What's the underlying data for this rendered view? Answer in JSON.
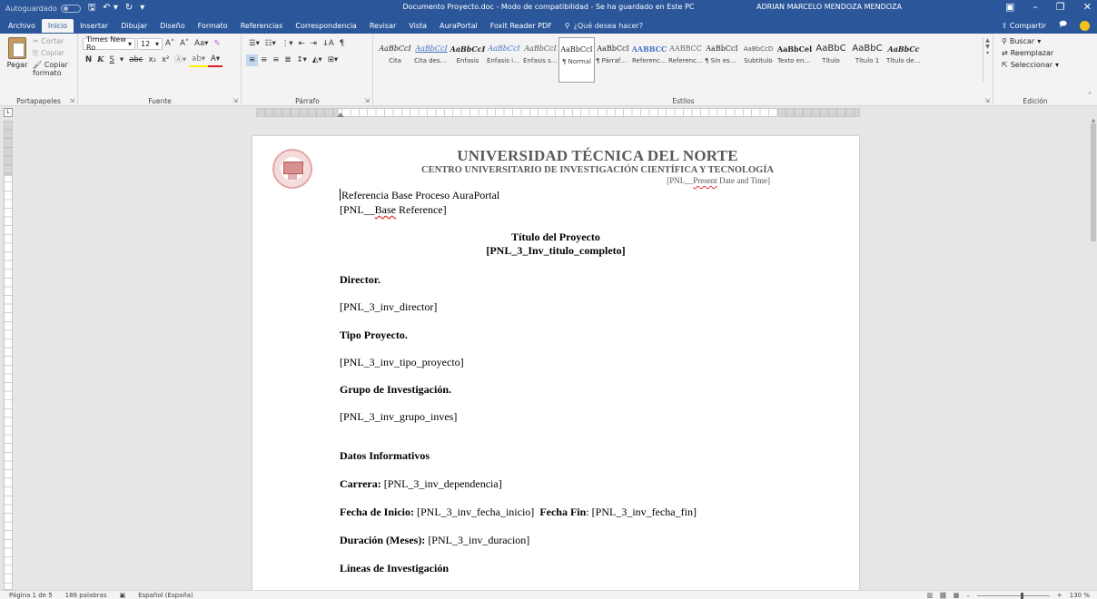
{
  "titlebar": {
    "autosave_label": "Autoguardado",
    "doc_title": "Documento Proyecto.doc - Modo de compatibilidad - Se ha guardado en Este PC",
    "user_name": "ADRIAN MARCELO MENDOZA MENDOZA"
  },
  "tabs": [
    "Archivo",
    "Inicio",
    "Insertar",
    "Dibujar",
    "Diseño",
    "Formato",
    "Referencias",
    "Correspondencia",
    "Revisar",
    "Vista",
    "AuraPortal",
    "Foxit Reader PDF"
  ],
  "tell_me": "¿Qué desea hacer?",
  "share_label": "Compartir",
  "clipboard": {
    "paste": "Pegar",
    "cut": "Cortar",
    "copy": "Copiar",
    "format_painter": "Copiar formato",
    "label": "Portapapeles"
  },
  "font": {
    "name": "Times New Ro",
    "size": "12",
    "label": "Fuente",
    "bold": "N",
    "italic": "K",
    "underline": "S"
  },
  "paragraph": {
    "label": "Párrafo"
  },
  "styles": {
    "label": "Estilos",
    "items": [
      {
        "sample": "AaBbCcI",
        "name": "Cita"
      },
      {
        "sample": "AaBbCcI",
        "name": "Cita desta..."
      },
      {
        "sample": "AaBbCcI",
        "name": "Énfasis"
      },
      {
        "sample": "AaBbCcI",
        "name": "Énfasis int..."
      },
      {
        "sample": "AaBbCcI",
        "name": "Énfasis sutil"
      },
      {
        "sample": "AaBbCcI",
        "name": "¶ Normal"
      },
      {
        "sample": "AaBbCcI",
        "name": "¶ Párrafo..."
      },
      {
        "sample": "AABBCC",
        "name": "Referencia..."
      },
      {
        "sample": "AABBCC",
        "name": "Referencia..."
      },
      {
        "sample": "AaBbCcI",
        "name": "¶ Sin espa..."
      },
      {
        "sample": "AaBbCcD",
        "name": "Subtítulo"
      },
      {
        "sample": "AaBbCel",
        "name": "Texto en n..."
      },
      {
        "sample": "AaBbC",
        "name": "Título"
      },
      {
        "sample": "AaBbC",
        "name": "Título 1"
      },
      {
        "sample": "AaBbCc",
        "name": "Título del..."
      }
    ]
  },
  "editing": {
    "find": "Buscar",
    "replace": "Reemplazar",
    "select": "Seleccionar",
    "label": "Edición"
  },
  "document": {
    "university": "UNIVERSIDAD TÉCNICA DEL NORTE",
    "center": "CENTRO UNIVERSITARIO DE INVESTIGACIÓN CIENTÍFICA Y TECNOLOGÍA",
    "date_prefix": "[PNL__",
    "date_word": "Present",
    "date_suffix": " Date and Time]",
    "ref_line1": "Referencia Base Proceso AuraPortal",
    "ref_line2_prefix": "[PNL__",
    "ref_line2_word": "Base",
    "ref_line2_suffix": " Reference]",
    "title_heading": "Título del Proyecto",
    "title_field": "[PNL_3_Inv_titulo_completo]",
    "director_label": "Director.",
    "director_field": "[PNL_3_inv_director]",
    "tipo_label": "Tipo Proyecto.",
    "tipo_field": "[PNL_3_inv_tipo_proyecto]",
    "grupo_label": "Grupo de Investigación.",
    "grupo_field": "[PNL_3_inv_grupo_inves]",
    "datos_label": "Datos Informativos",
    "carrera_label": "Carrera:",
    "carrera_field": " [PNL_3_inv_dependencia]",
    "fecha_inicio_label": "Fecha de Inicio:",
    "fecha_inicio_field": " [PNL_3_inv_fecha_inicio]",
    "fecha_fin_label": "Fecha Fin",
    "fecha_fin_field": ": [PNL_3_inv_fecha_fin]",
    "duracion_label": "Duración (Meses):",
    "duracion_field": " [PNL_3_inv_duracion]",
    "lineas_label": "Líneas de Investigación"
  },
  "status": {
    "page": "Página 1 de 5",
    "words": "186 palabras",
    "language": "Español (España)",
    "zoom": "130 %"
  }
}
